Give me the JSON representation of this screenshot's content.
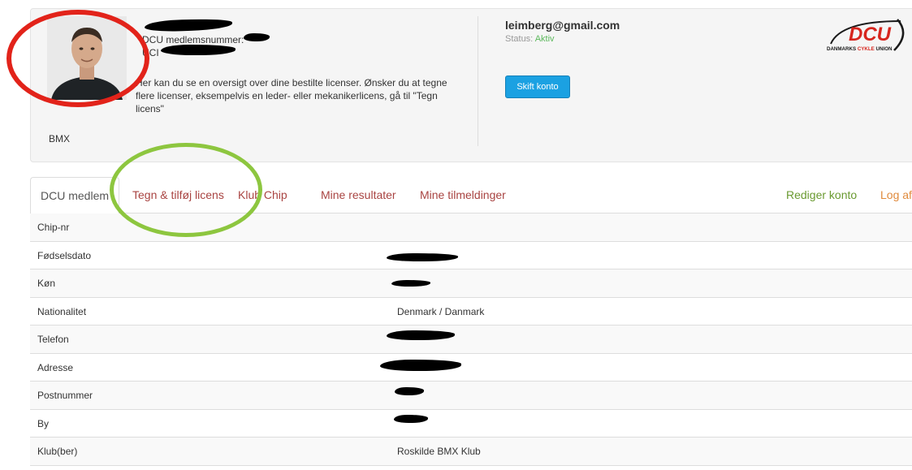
{
  "profile": {
    "member_number_label": "DCU medlemsnummer:",
    "uci_label": "UCI",
    "intro": "Her kan du se en oversigt over dine bestilte licenser. Ønsker du at tegne flere licenser, eksempelvis en leder- eller mekanikerlicens, gå til \"Tegn licens\"",
    "discipline": "BMX"
  },
  "account": {
    "email": "leimberg@gmail.com",
    "status_label": "Status:",
    "status_value": "Aktiv",
    "switch_button": "Skift konto"
  },
  "logo": {
    "text": "DCU",
    "subtitle_left": "DANMARKS",
    "subtitle_mid": "CYKLE",
    "subtitle_right": "UNION"
  },
  "tabs": {
    "member": "DCU medlem",
    "license": "Tegn & tilføj licens",
    "chip": "Klub Chip",
    "results": "Mine resultater",
    "signups": "Mine tilmeldinger",
    "edit": "Rediger konto",
    "logout": "Log af"
  },
  "details": {
    "rows": [
      {
        "label": "Chip-nr",
        "value": ""
      },
      {
        "label": "Fødselsdato",
        "value": ""
      },
      {
        "label": "Køn",
        "value": ""
      },
      {
        "label": "Nationalitet",
        "value": "Denmark / Danmark"
      },
      {
        "label": "Telefon",
        "value": ""
      },
      {
        "label": "Adresse",
        "value": ""
      },
      {
        "label": "Postnummer",
        "value": ""
      },
      {
        "label": "By",
        "value": ""
      },
      {
        "label": "Klub(ber)",
        "value": "Roskilde BMX Klub"
      }
    ]
  },
  "colors": {
    "accent_blue": "#1ba1e2",
    "tab_red": "#a94442",
    "status_green": "#5cb85c",
    "annotation_red": "#e2231a",
    "annotation_green": "#8dc63f"
  }
}
